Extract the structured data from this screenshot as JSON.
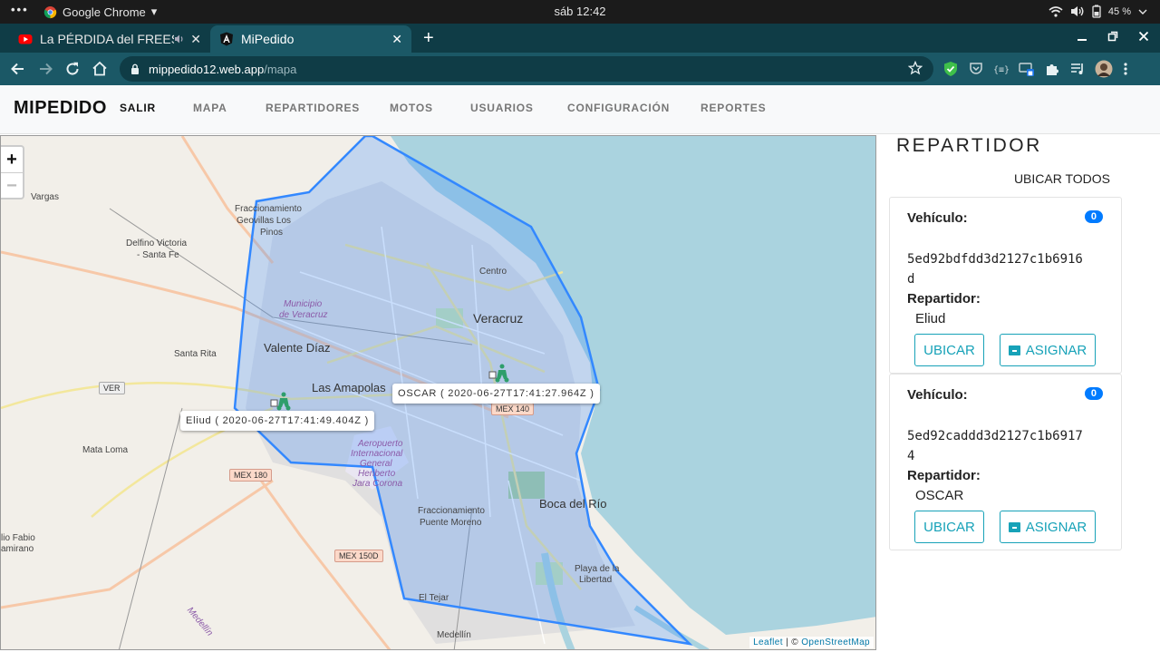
{
  "os": {
    "menu_dots": "•••",
    "app_name": "Google Chrome",
    "app_caret": "▾",
    "clock": "sáb 12:42",
    "battery": "45 %"
  },
  "browser": {
    "tabs": [
      {
        "title": "La PÉRDIDA del FREESTYLE",
        "icon": "youtube-icon"
      },
      {
        "title": "MiPedido",
        "icon": "angular-icon"
      }
    ],
    "close_glyph": "✕",
    "new_tab_glyph": "+",
    "url_host": "mippedido12.web.app",
    "url_path": "/mapa"
  },
  "app": {
    "brand": "MIPEDIDO",
    "nav": [
      {
        "label": "SALIR",
        "active": true
      },
      {
        "label": "MAPA",
        "active": false
      },
      {
        "label": "REPARTIDORES",
        "active": false
      },
      {
        "label": "MOTOS",
        "active": false
      },
      {
        "label": "USUARIOS",
        "active": false
      },
      {
        "label": "CONFIGURACIÓN",
        "active": false
      },
      {
        "label": "REPORTES",
        "active": false
      }
    ]
  },
  "map": {
    "zoom_in": "+",
    "zoom_out": "−",
    "labels": {
      "vargas": "Vargas",
      "fracc_geovillas_1": "Fraccionamiento",
      "fracc_geovillas_2": "Geovillas Los",
      "fracc_geovillas_3": "Pinos",
      "delfino_1": "Delfino Victoria",
      "delfino_2": "- Santa Fe",
      "centro": "Centro",
      "municipio_1": "Municipio",
      "municipio_2": "de Veracruz",
      "veracruz": "Veracruz",
      "santa_rita": "Santa Rita",
      "valente_diaz": "Valente Díaz",
      "las_amapolas": "Las Amapolas",
      "mata_loma": "Mata Loma",
      "aeropuerto_1": "Aeropuerto",
      "aeropuerto_2": "Internacional",
      "aeropuerto_3": "General",
      "aeropuerto_4": "Heriberto",
      "aeropuerto_5": "Jara Corona",
      "boca_del_rio": "Boca del Río",
      "fracc_puente_1": "Fraccionamiento",
      "fracc_puente_2": "Puente Moreno",
      "playa_1": "Playa de la",
      "playa_2": "Libertad",
      "el_tejar": "El Tejar",
      "medellin": "Medellín",
      "medellin_river": "Medellín",
      "fabio_1": "lio Fabio",
      "fabio_2": "amirano"
    },
    "shields": {
      "ver": "VER",
      "mex180": "MEX 180",
      "mex150d": "MEX 150D",
      "mex140": "MEX 140"
    },
    "tooltips": {
      "oscar": "OSCAR ( 2020-06-27T17:41:27.964Z )",
      "eliud": "Eliud ( 2020-06-27T17:41:49.404Z )"
    },
    "attribution_leaflet": "Leaflet",
    "attribution_sep": " | © ",
    "attribution_osm": "OpenStreetMap",
    "zone_color": "#3388ff"
  },
  "panel": {
    "title": "REPARTIDOR",
    "locate_all": "UBICAR TODOS",
    "vehicle_label": "Vehículo:",
    "driver_label": "Repartidor:",
    "locate_button": "UBICAR",
    "assign_button": "ASIGNAR",
    "cards": [
      {
        "badge": "0",
        "vehicle_id": "5ed92bdfdd3d2127c1b6916d",
        "driver": "Eliud"
      },
      {
        "badge": "0",
        "vehicle_id": "5ed92caddd3d2127c1b69174",
        "driver": "OSCAR"
      }
    ]
  }
}
